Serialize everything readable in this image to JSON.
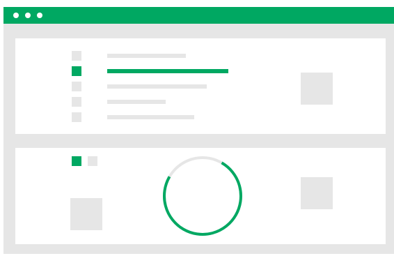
{
  "colors": {
    "accent": "#00a862",
    "placeholder": "#e6e6e6",
    "background": "#ffffff",
    "ring_track": "#e6e6e6"
  },
  "window": {
    "titlebar_controls": [
      "window-dot-icon",
      "window-dot-icon",
      "window-dot-icon"
    ]
  },
  "list_panel": {
    "rows": [
      {
        "selected": false,
        "line_fraction": 0.65
      },
      {
        "selected": true,
        "line_fraction": 1.0
      },
      {
        "selected": false,
        "line_fraction": 0.82
      },
      {
        "selected": false,
        "line_fraction": 0.48
      },
      {
        "selected": false,
        "line_fraction": 0.72
      }
    ],
    "thumbnail_icon": "image-placeholder-icon"
  },
  "progress_panel": {
    "legend": [
      {
        "active": true
      },
      {
        "active": false
      }
    ],
    "progress": 0.75,
    "thumbnail_icon": "image-placeholder-icon"
  }
}
